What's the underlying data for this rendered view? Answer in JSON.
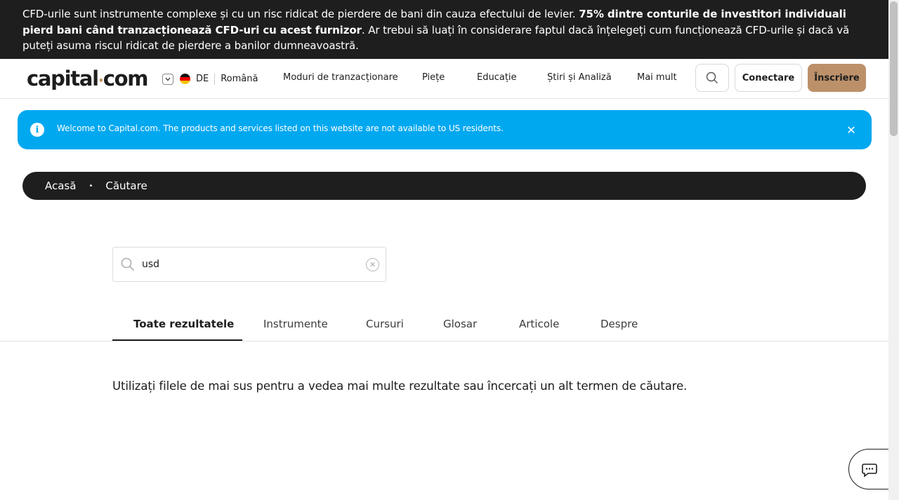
{
  "risk_warning": {
    "part1": "CFD-urile sunt instrumente complexe și cu un risc ridicat de pierdere de bani din cauza efectului de levier. ",
    "bold": "75% dintre conturile de investitori individuali pierd bani când tranzacționează CFD-uri cu acest furnizor",
    "part2": ". Ar trebui să luați în considerare faptul dacă înțelegeți cum funcționează CFD-urile și dacă vă puteți asuma riscul ridicat de pierdere a banilor dumneavoastră."
  },
  "header": {
    "logo_left": "capital",
    "logo_dot": "·",
    "logo_right": "com",
    "country_code": "DE",
    "language": "Română",
    "nav": [
      "Moduri de tranzacționare",
      "Piețe",
      "Educație",
      "Știri și Analiză",
      "Mai mult"
    ],
    "login_label": "Conectare",
    "signup_label": "Înscriere"
  },
  "alert": {
    "text": "Welcome to Capital.com. The products and services listed on this website are not available to US residents.",
    "close_glyph": "✕"
  },
  "breadcrumb": {
    "home": "Acasă",
    "separator": "•",
    "current": "Căutare"
  },
  "search": {
    "value": "usd",
    "clear_glyph": "✕"
  },
  "tabs": [
    "Toate rezultatele",
    "Instrumente",
    "Cursuri",
    "Glosar",
    "Articole",
    "Despre"
  ],
  "active_tab": "Toate rezultatele",
  "hint_text": "Utilizați filele de mai sus pentru a vedea mai multe rezultate sau încercați un alt termen de căutare.",
  "colors": {
    "dark": "#1e1e1e",
    "accent_gold": "#bc916a",
    "alert_blue": "#00a8f0"
  },
  "icons": {
    "search": "magnifier-icon",
    "info": "info-icon",
    "chat": "chat-bubble-icon"
  }
}
